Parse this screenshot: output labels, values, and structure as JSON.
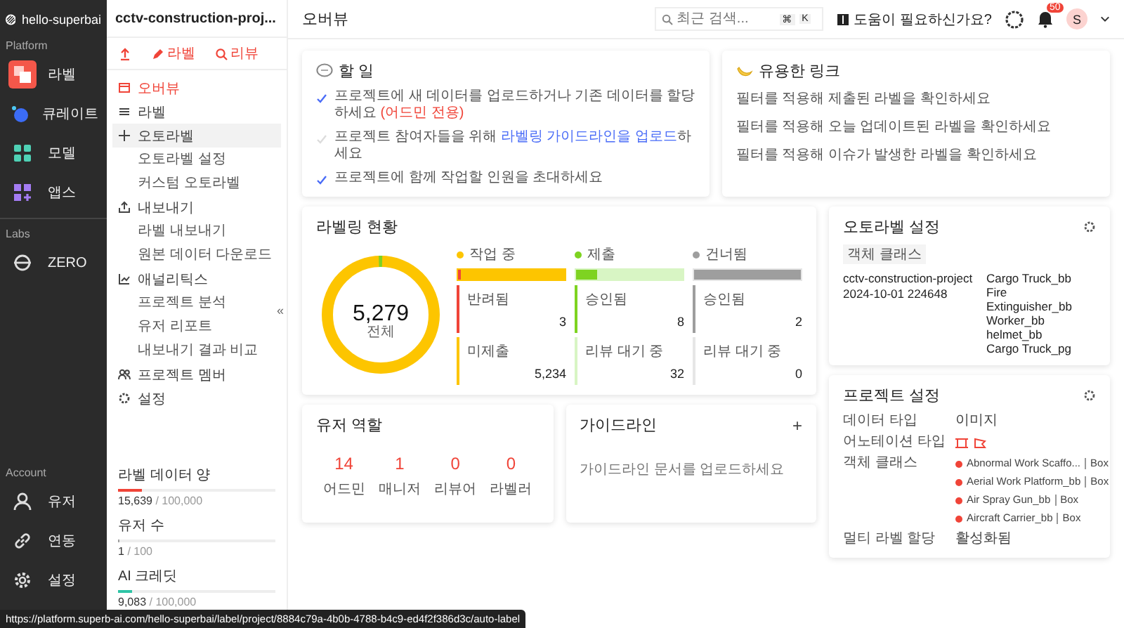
{
  "sidebar": {
    "workspace": "hello-superbai",
    "sections": [
      {
        "title": "Platform",
        "items": [
          {
            "label": "라벨",
            "selected": true
          },
          {
            "label": "큐레이트",
            "selected": false
          },
          {
            "label": "모델",
            "selected": false
          },
          {
            "label": "앱스",
            "selected": false
          }
        ]
      },
      {
        "title": "Labs",
        "items": [
          {
            "label": "ZERO",
            "selected": false
          }
        ]
      },
      {
        "title": "Account",
        "items": [
          {
            "label": "유저",
            "selected": false
          },
          {
            "label": "연동",
            "selected": false
          },
          {
            "label": "설정",
            "selected": false
          }
        ]
      }
    ]
  },
  "project_nav": {
    "project": "cctv-construction-proj...",
    "toolbar": [
      {
        "kind": "upload"
      },
      {
        "kind": "label",
        "label": "라벨"
      },
      {
        "kind": "review",
        "label": "리뷰"
      }
    ],
    "items": [
      {
        "label": "오버뷰",
        "selected": true,
        "hovered": false
      },
      {
        "label": "라벨",
        "selected": false,
        "hovered": false
      },
      {
        "label": "오토라벨",
        "selected": false,
        "hovered": true,
        "children": [
          {
            "label": "오토라벨 설정",
            "selected": false
          },
          {
            "label": "커스텀 오토라벨",
            "selected": false
          }
        ]
      },
      {
        "label": "내보내기",
        "selected": false,
        "hovered": false,
        "children": [
          {
            "label": "라벨 내보내기",
            "selected": false
          },
          {
            "label": "원본 데이터 다운로드",
            "selected": false
          }
        ]
      },
      {
        "label": "애널리틱스",
        "selected": false,
        "hovered": false,
        "children": [
          {
            "label": "프로젝트 분석",
            "selected": false
          },
          {
            "label": "유저 리포트",
            "selected": false
          },
          {
            "label": "내보내기 결과 비교",
            "selected": false
          }
        ]
      },
      {
        "label": "프로젝트 멤버",
        "selected": false,
        "hovered": false
      },
      {
        "label": "설정",
        "selected": false,
        "hovered": false
      }
    ],
    "collapse": "«",
    "usage": [
      {
        "label": "라벨 데이터 양",
        "value": "15,639",
        "limit": "/ 100,000",
        "level": 0.156,
        "color": "#f04438"
      },
      {
        "label": "유저 수",
        "value": "1",
        "limit": "/ 100",
        "level": 0.01,
        "color": "#9e9e9e"
      },
      {
        "label": "AI 크레딧",
        "value": "9,083",
        "limit": "/ 100,000",
        "level": 0.09,
        "color": "#2ec4a6"
      }
    ]
  },
  "header": {
    "title": "오버뷰",
    "search": {
      "placeholder": "최근 검색...",
      "keys": [
        "⌘",
        "K"
      ]
    },
    "help": "도움이 필요하신가요?",
    "notifications": "50",
    "avatar": "S"
  },
  "todo": {
    "title": "할 일",
    "items": [
      {
        "text": "프로젝트에 새 데이터를 업로드하거나 기존 데이터를 할당하세요 ",
        "note": "(어드민 전용)",
        "done": true
      },
      {
        "text": "프로젝트 참여자들을 위해 ",
        "link": "라벨링 가이드라인을 업로드",
        "after": "하세요",
        "done": false
      },
      {
        "text": "프로젝트에 함께 작업할 인원을 초대하세요",
        "done": true
      }
    ]
  },
  "useful_links": {
    "title": "유용한 링크",
    "items": [
      "필터를 적용해 제출된 라벨을 확인하세요",
      "필터를 적용해 오늘 업데이트된 라벨을 확인하세요",
      "필터를 적용해 이슈가 발생한 라벨을 확인하세요"
    ]
  },
  "labeling_status": {
    "title": "라벨링 현황",
    "total": "5,279",
    "total_label": "전체",
    "groups": [
      {
        "label": "작업 중",
        "color": "#fdc500",
        "level": 0.03,
        "stats": [
          {
            "label": "반려됨",
            "value": "3",
            "color": "#f04438"
          },
          {
            "label": "미제출",
            "value": "5,234",
            "color": "#fdc500"
          }
        ]
      },
      {
        "label": "제출",
        "color": "#7ed321",
        "level": 0.2,
        "stats": [
          {
            "label": "승인됨",
            "value": "8",
            "color": "#7ed321"
          },
          {
            "label": "리뷰 대기 중",
            "value": "32",
            "color": "#d8f5c4"
          }
        ]
      },
      {
        "label": "건너뜀",
        "color": "#9e9e9e",
        "level": 1,
        "stats": [
          {
            "label": "승인됨",
            "value": "2",
            "color": "#9e9e9e"
          },
          {
            "label": "리뷰 대기 중",
            "value": "0",
            "color": "#e6e6e6"
          }
        ]
      }
    ]
  },
  "user_roles": {
    "title": "유저 역할",
    "roles": [
      {
        "count": "14",
        "label": "어드민"
      },
      {
        "count": "1",
        "label": "매니저"
      },
      {
        "count": "0",
        "label": "리뷰어"
      },
      {
        "count": "0",
        "label": "라벨러"
      }
    ]
  },
  "guidelines": {
    "title": "가이드라인",
    "add": "+",
    "empty": "가이드라인 문서를 업로드하세요"
  },
  "autolabel_settings": {
    "title": "오토라벨 설정",
    "tag": "객체 클래스",
    "project": "cctv-construction-project 2024-10-01 224648",
    "classes": [
      "Cargo Truck_bb",
      "Fire",
      "Extinguisher_bb",
      "Worker_bb",
      "helmet_bb",
      "Cargo Truck_pg"
    ]
  },
  "project_settings": {
    "title": "프로젝트 설정",
    "data_type_label": "데이터 타입",
    "data_type": "이미지",
    "annotation_label": "어노테이션 타입",
    "annotation_types": [
      {
        "kind": "box"
      },
      {
        "kind": "polygon"
      }
    ],
    "classes_label": "객체 클래스",
    "classes": [
      {
        "name": "Abnormal Work Scaffo...",
        "type": "Box",
        "color": "#f04438"
      },
      {
        "name": "Aerial Work Platform_bb",
        "type": "Box",
        "color": "#f04438"
      },
      {
        "name": "Air Spray Gun_bb",
        "type": "Box",
        "color": "#f04438"
      },
      {
        "name": "Aircraft Carrier_bb",
        "type": "Box",
        "color": "#f04438"
      }
    ],
    "multi_label": "멀티 라벨 할당",
    "multi_label_value": "활성화됨"
  },
  "status_url": "https://platform.superb-ai.com/hello-superbai/label/project/8884c79a-4b0b-4788-b4c9-ed4f2f386d3c/auto-label"
}
